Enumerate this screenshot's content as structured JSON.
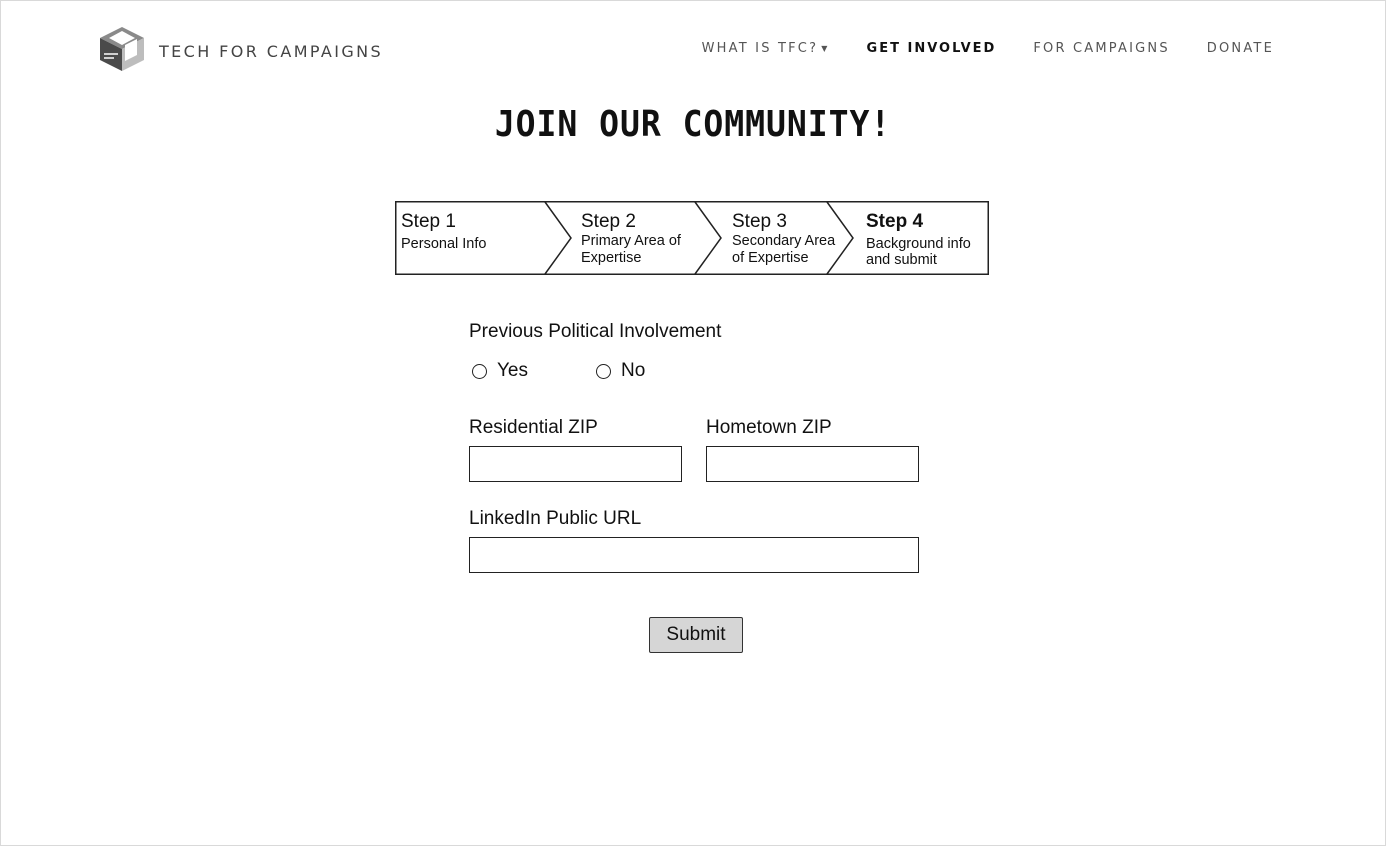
{
  "brand": {
    "name": "TECH FOR CAMPAIGNS",
    "logo_icon": "cube-logo-icon"
  },
  "nav": [
    {
      "label": "WHAT IS TFC?",
      "has_dropdown": true
    },
    {
      "label": "GET INVOLVED",
      "active": true
    },
    {
      "label": "FOR CAMPAIGNS"
    },
    {
      "label": "DONATE"
    }
  ],
  "title": "JOIN OUR COMMUNITY!",
  "steps": [
    {
      "num": "Step 1",
      "sub1": "Personal Info",
      "sub2": ""
    },
    {
      "num": "Step 2",
      "sub1": "Primary Area of",
      "sub2": "Expertise"
    },
    {
      "num": "Step 3",
      "sub1": "Secondary Area",
      "sub2": "of Expertise"
    },
    {
      "num": "Step 4",
      "sub1": "Background info",
      "sub2": "and submit",
      "current": true
    }
  ],
  "form": {
    "political_label": "Previous Political Involvement",
    "radio_yes": "Yes",
    "radio_no": "No",
    "residential_zip_label": "Residential ZIP",
    "residential_zip_value": "",
    "hometown_zip_label": "Hometown ZIP",
    "hometown_zip_value": "",
    "linkedin_label": "LinkedIn Public URL",
    "linkedin_value": "",
    "submit_label": "Submit"
  }
}
